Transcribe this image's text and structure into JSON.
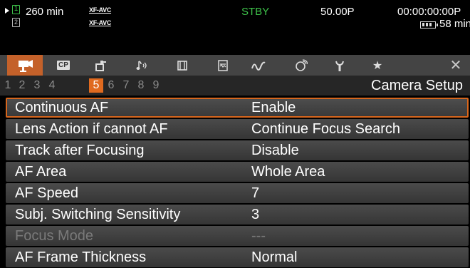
{
  "status": {
    "remaining_time": "260 min",
    "format_1": "XF-AVC",
    "format_2": "XF-AVC",
    "card_1": "1",
    "card_2": "2",
    "mode": "STBY",
    "frame_rate": "50.00P",
    "timecode": "00:00:00:00",
    "timecode_suffix": "P",
    "battery_time": "58 min",
    "colors": {
      "mode": "#3ec24a",
      "card": "#3ec24a"
    }
  },
  "tabs": [
    {
      "name": "camera-setup-icon",
      "active": true
    },
    {
      "name": "custom-picture-icon",
      "label": "CP"
    },
    {
      "name": "rec-media-setup-icon"
    },
    {
      "name": "audio-setup-icon"
    },
    {
      "name": "video-setup-icon"
    },
    {
      "name": "playback-icon"
    },
    {
      "name": "assistance-functions-icon"
    },
    {
      "name": "network-icon"
    },
    {
      "name": "system-setup-icon"
    },
    {
      "name": "my-menu-star-icon"
    },
    {
      "name": "close-icon"
    }
  ],
  "pages": {
    "numbers": [
      "1",
      "2",
      "3",
      "4",
      "5",
      "6",
      "7",
      "8",
      "9"
    ],
    "active": "5",
    "title": "Camera Setup",
    "accent_color": "#e06a1f"
  },
  "menu": {
    "items": [
      {
        "label": "Continuous AF",
        "value": "Enable",
        "selected": true
      },
      {
        "label": "Lens Action if cannot AF",
        "value": "Continue Focus Search"
      },
      {
        "label": "Track after Focusing",
        "value": "Disable"
      },
      {
        "label": "AF Area",
        "value": "Whole Area"
      },
      {
        "label": "AF Speed",
        "value": "7"
      },
      {
        "label": "Subj. Switching Sensitivity",
        "value": "3"
      },
      {
        "label": "Focus Mode",
        "value": "---",
        "disabled": true
      },
      {
        "label": "AF Frame Thickness",
        "value": "Normal"
      }
    ]
  }
}
